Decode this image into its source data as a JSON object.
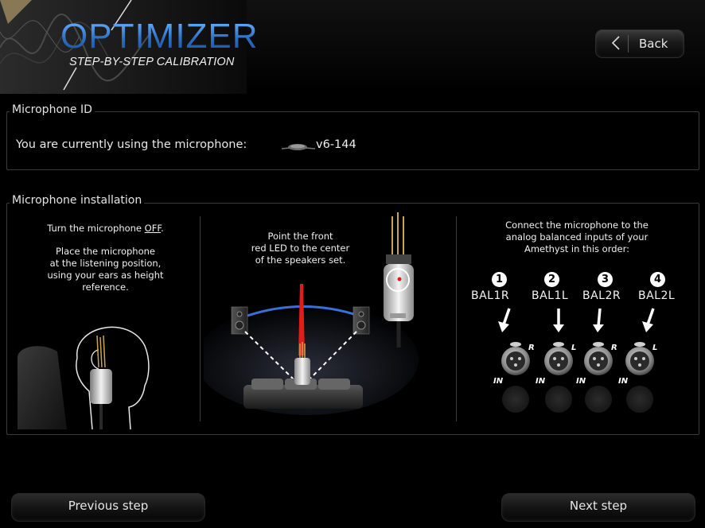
{
  "header": {
    "logo_title": "OPTIMIZER",
    "logo_subtitle": "STEP-BY-STEP CALIBRATION",
    "back_label": "Back"
  },
  "microphone_id": {
    "group_title": "Microphone ID",
    "label": "You are currently using the microphone:",
    "value": "v6-144",
    "icon": "microphone-icon"
  },
  "installation": {
    "group_title": "Microphone installation",
    "col1": {
      "line1_prefix": "Turn the microphone ",
      "line1_emph": "OFF",
      "line1_suffix": ".",
      "text_lines": [
        "Place the microphone",
        "at the listening position,",
        "using your ears as height",
        "reference."
      ]
    },
    "col2": {
      "text_lines": [
        "Point the front",
        "red LED to the center",
        "of the speakers set."
      ]
    },
    "col3": {
      "text_lines": [
        "Connect the microphone to the",
        "analog balanced inputs of your",
        "Amethyst in this order:"
      ],
      "inputs": [
        {
          "num": "1",
          "label": "BAL1R",
          "side": "R",
          "io": "IN"
        },
        {
          "num": "2",
          "label": "BAL1L",
          "side": "L",
          "io": "IN"
        },
        {
          "num": "3",
          "label": "BAL2R",
          "side": "R",
          "io": "IN"
        },
        {
          "num": "4",
          "label": "BAL2L",
          "side": "L",
          "io": "IN"
        }
      ]
    }
  },
  "footer": {
    "previous_label": "Previous step",
    "next_label": "Next step"
  },
  "colors": {
    "accent_blue": "#2f7fd6",
    "background": "#000000",
    "led_red": "#e21b1b"
  }
}
